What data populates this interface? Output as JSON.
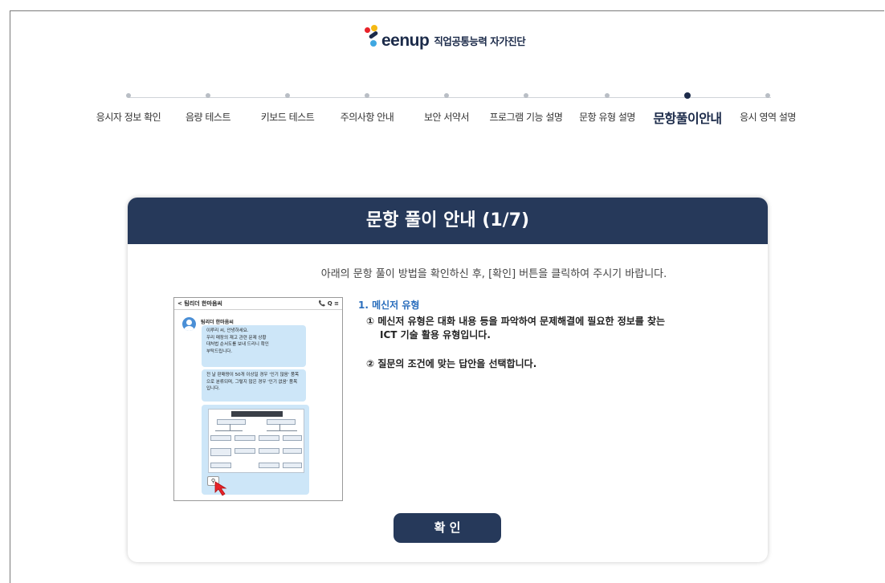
{
  "logo": {
    "brand": "eenup",
    "subtitle": "직업공통능력 자가진단",
    "dot_colors": [
      "#e8232a",
      "#f5b914",
      "#1c2b4a",
      "#3fa7e1"
    ]
  },
  "steps": [
    {
      "label": "응시자 정보 확인",
      "active": false
    },
    {
      "label": "음량 테스트",
      "active": false
    },
    {
      "label": "키보드 테스트",
      "active": false
    },
    {
      "label": "주의사항 안내",
      "active": false
    },
    {
      "label": "보안 서약서",
      "active": false
    },
    {
      "label": "프로그램 기능 설명",
      "active": false
    },
    {
      "label": "문항 유형 설명",
      "active": false
    },
    {
      "label": "문항풀이안내",
      "active": true
    },
    {
      "label": "응시 영역 설명",
      "active": false
    }
  ],
  "dialog": {
    "title": "문항 풀이 안내 (1/7)",
    "intro": "아래의 문항 풀이 방법을 확인하신 후, [확인] 버튼을 클릭하여 주시기 바랍니다.",
    "section_title": "1. 메신저 유형",
    "item1_line1": "① 메신저 유형은 대화 내용 등을 파악하여 문제해결에 필요한 정보를 찾는",
    "item1_line2": "ICT 기술 활용 유형입니다.",
    "item2": "② 질문의 조건에 맞는 답안을 선택합니다.",
    "confirm_label": "확 인"
  },
  "phone": {
    "chat_title": "< 팀리더 한마음씨",
    "top_icons": "📞 Q ≡",
    "sender_name": "팀리더 한마음씨",
    "bubble1": "이루리 씨, 안녕하세요.\n우리 매장의 재고 관련 문제 상황\n대처법 순서도를 보내 드리니 확인\n부탁드립니다.",
    "bubble2": "전 날 판매량이 50개 이상일 경우 '인기 많음' 품목으로 분류되며, 그렇지 않은 경우 '인기 없음' 품목입니다.",
    "zoom_glyph": "⚲"
  },
  "colors": {
    "header_bg": "#26395a",
    "accent_blue": "#2a6ebd",
    "bubble_bg": "#cde6f8"
  }
}
